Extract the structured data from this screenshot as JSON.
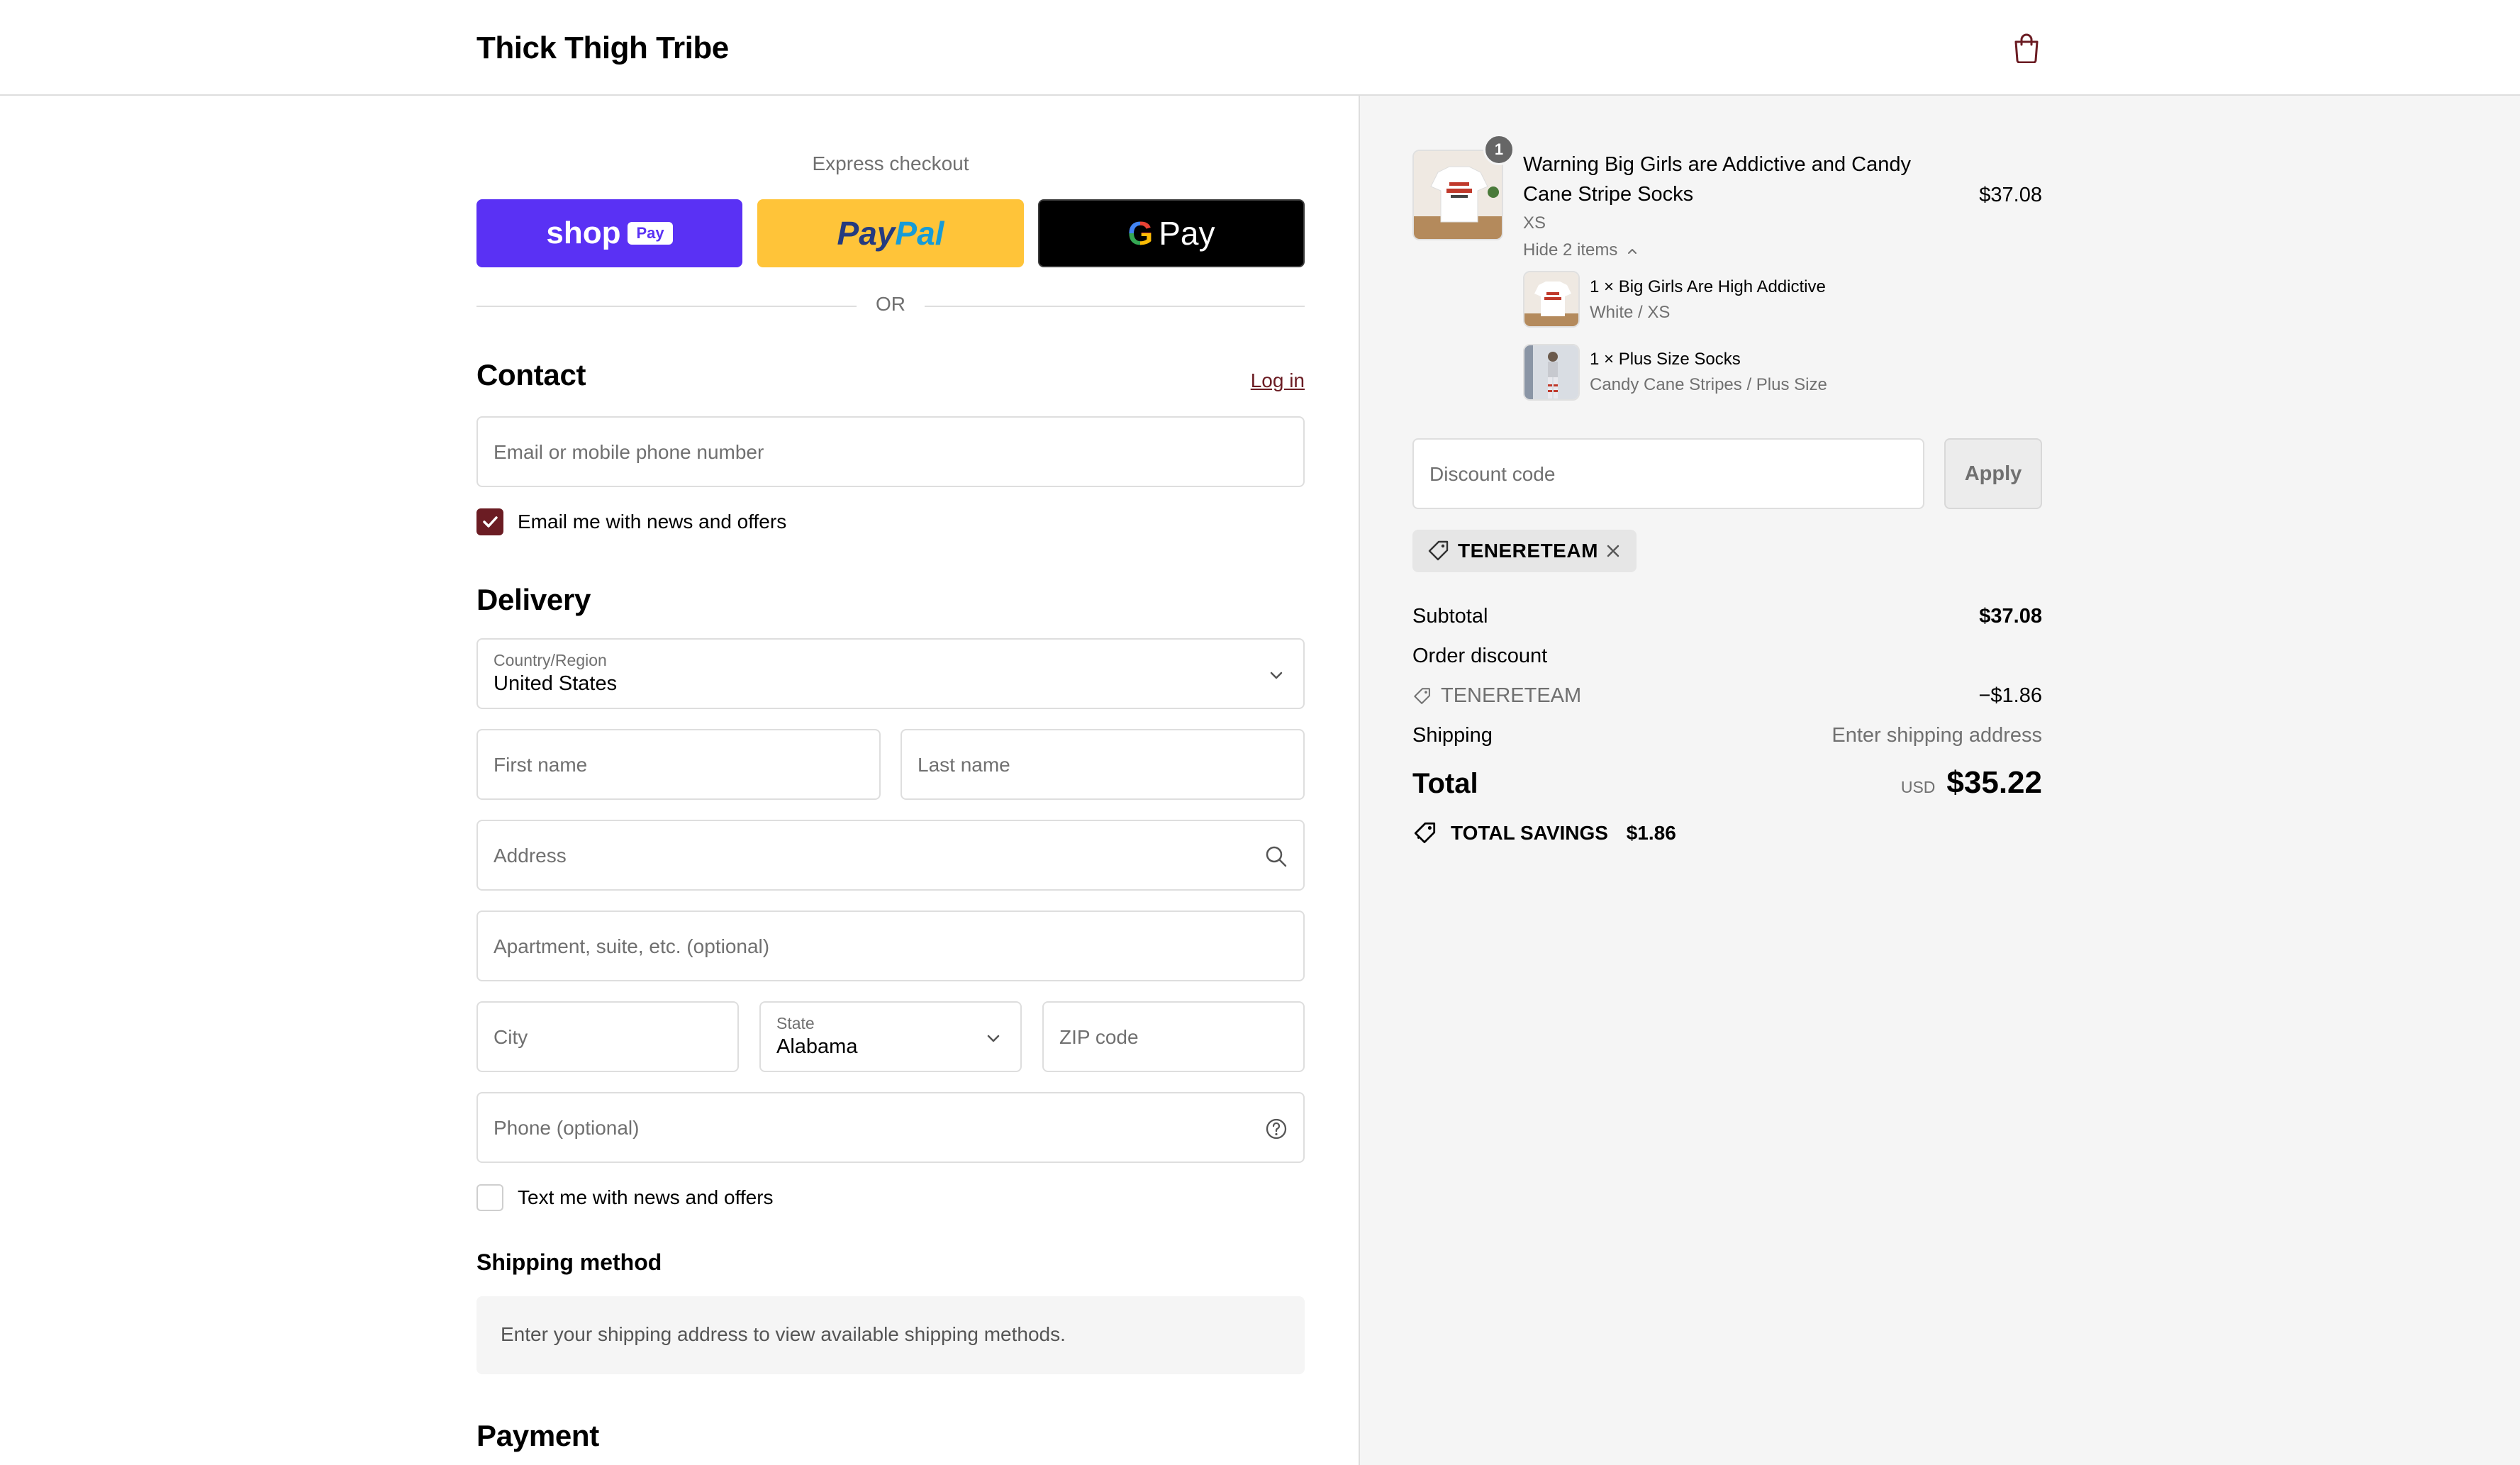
{
  "header": {
    "brand": "Thick Thigh Tribe",
    "cart_icon": "shopping-bag-icon"
  },
  "express": {
    "title": "Express checkout",
    "shop_label": "shop",
    "shop_pill": "Pay",
    "paypal_a": "Pay",
    "paypal_b": "Pal",
    "gpay_g": "G",
    "gpay_label": "Pay",
    "or": "OR"
  },
  "contact": {
    "title": "Contact",
    "login": "Log in",
    "email_placeholder": "Email or mobile phone number",
    "news_label": "Email me with news and offers",
    "news_checked": true
  },
  "delivery": {
    "title": "Delivery",
    "country_label": "Country/Region",
    "country_value": "United States",
    "first_name": "First name",
    "last_name": "Last name",
    "address": "Address",
    "apartment": "Apartment, suite, etc. (optional)",
    "city": "City",
    "state_label": "State",
    "state_value": "Alabama",
    "zip": "ZIP code",
    "phone": "Phone (optional)",
    "text_label": "Text me with news and offers",
    "text_checked": false
  },
  "shipping": {
    "title": "Shipping method",
    "info": "Enter your shipping address to view available shipping methods."
  },
  "payment": {
    "title": "Payment"
  },
  "order": {
    "item": {
      "quantity": "1",
      "name_line1": "Warning Big Girls are Addictive and Candy",
      "name_line2": "Cane Stripe Socks",
      "variant": "XS",
      "price": "$37.08",
      "toggle": "Hide 2 items"
    },
    "sub_items": [
      {
        "name": "1 × Big Girls Are High Addictive",
        "variant": "White / XS"
      },
      {
        "name": "1 × Plus Size Socks",
        "variant": "Candy Cane Stripes / Plus Size"
      }
    ],
    "discount_placeholder": "Discount code",
    "apply": "Apply",
    "applied_code": "TENERETEAM",
    "summary": {
      "subtotal_label": "Subtotal",
      "subtotal_value": "$37.08",
      "order_discount_label": "Order discount",
      "discount_code": "TENERETEAM",
      "discount_value": "−$1.86",
      "shipping_label": "Shipping",
      "shipping_value": "Enter shipping address",
      "total_label": "Total",
      "currency": "USD",
      "total_value": "$35.22",
      "savings_label": "TOTAL SAVINGS",
      "savings_value": "$1.86"
    }
  },
  "colors": {
    "accent": "#6b1c23",
    "shop_pay": "#5a31f4",
    "paypal": "#ffc439",
    "gpay": "#000000"
  }
}
